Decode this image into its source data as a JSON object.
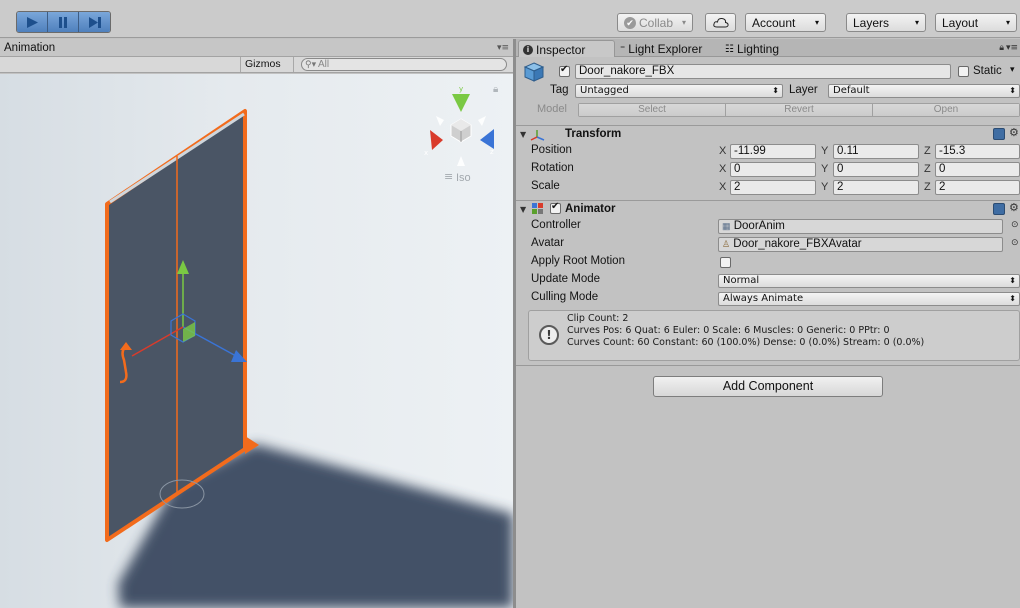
{
  "toolbar": {
    "collab_label": "Collab",
    "account_label": "Account",
    "layers_label": "Layers",
    "layout_label": "Layout"
  },
  "scene": {
    "tab_title": "Animation",
    "gizmos_label": "Gizmos",
    "search_placeholder": "All",
    "iso_label": "Iso",
    "colors": {
      "selection_outline": "#f26b1c",
      "door_panel": "#4a5565",
      "shadow": "#3a4a60"
    }
  },
  "inspector": {
    "tabs": [
      {
        "label": "Inspector",
        "icon": "info-icon"
      },
      {
        "label": "Light Explorer",
        "icon": "list-icon"
      },
      {
        "label": "Lighting",
        "icon": "lighting-icon"
      }
    ],
    "object_name": "Door_nakore_FBX",
    "active": true,
    "static_label": "Static",
    "tag_label": "Tag",
    "tag_value": "Untagged",
    "layer_label": "Layer",
    "layer_value": "Default",
    "model_label": "Model",
    "model_buttons": [
      "Select",
      "Revert",
      "Open"
    ],
    "transform": {
      "title": "Transform",
      "rows": [
        {
          "label": "Position",
          "x": "-11.99",
          "y": "0.11",
          "z": "-15.3"
        },
        {
          "label": "Rotation",
          "x": "0",
          "y": "0",
          "z": "0"
        },
        {
          "label": "Scale",
          "x": "2",
          "y": "2",
          "z": "2"
        }
      ],
      "axis_labels": [
        "X",
        "Y",
        "Z"
      ]
    },
    "animator": {
      "title": "Animator",
      "enabled": true,
      "controller_label": "Controller",
      "controller_value": "DoorAnim",
      "avatar_label": "Avatar",
      "avatar_value": "Door_nakore_FBXAvatar",
      "apply_root_motion_label": "Apply Root Motion",
      "apply_root_motion": false,
      "update_mode_label": "Update Mode",
      "update_mode_value": "Normal",
      "culling_mode_label": "Culling Mode",
      "culling_mode_value": "Always Animate",
      "info_lines": [
        "Clip Count: 2",
        "Curves Pos: 6 Quat: 6 Euler: 0 Scale: 6 Muscles: 0 Generic: 0 PPtr: 0",
        "Curves Count: 60 Constant: 60 (100.0%) Dense: 0 (0.0%) Stream: 0 (0.0%)"
      ]
    },
    "add_component_label": "Add Component"
  }
}
